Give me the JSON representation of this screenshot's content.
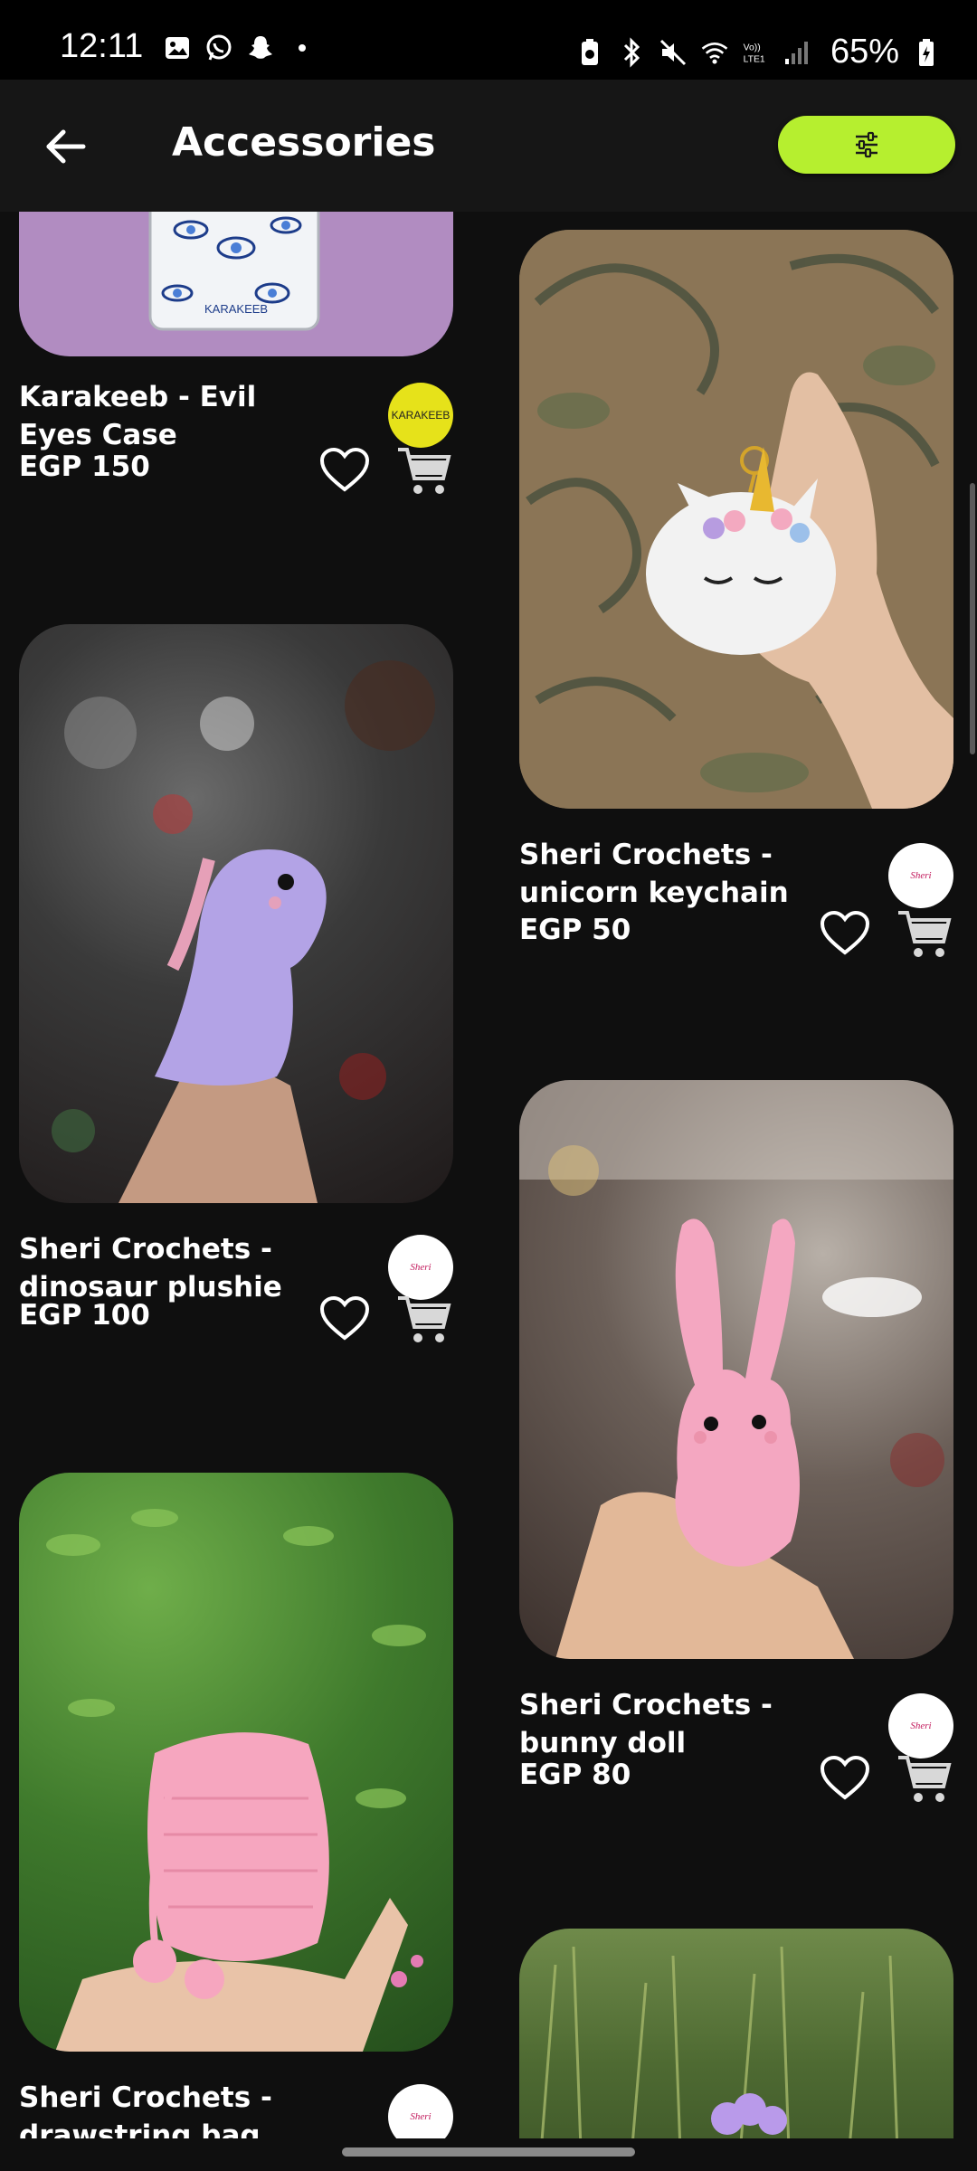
{
  "status_bar": {
    "time": "12:11",
    "battery": "65%",
    "left_icons": [
      "gallery-icon",
      "whatsapp-icon",
      "snapchat-icon",
      "dot-icon"
    ],
    "right_icons": [
      "battery-saver-icon",
      "bluetooth-icon",
      "mute-icon",
      "wifi-icon",
      "volte-icon",
      "signal-icon",
      "battery-icon"
    ]
  },
  "header": {
    "title": "Accessories",
    "back_icon": "arrow-left-icon",
    "filter_icon": "sliders-icon",
    "filter_color": "#b6ef2f"
  },
  "products": [
    {
      "title": "Karakeeb  - Evil Eyes Case",
      "price": "EGP 150",
      "logo_text": "KARAKEEB"
    },
    {
      "title": "Sheri Crochets - unicorn keychain",
      "price": "EGP 50",
      "logo_text": "Sheri"
    },
    {
      "title": "Sheri Crochets - dinosaur plushie",
      "price": "EGP 100",
      "logo_text": "Sheri"
    },
    {
      "title": "Sheri Crochets - bunny doll",
      "price": "EGP 80",
      "logo_text": "Sheri"
    },
    {
      "title": "Sheri Crochets - drawstring bag",
      "price": "",
      "logo_text": "Sheri"
    }
  ],
  "colors": {
    "background": "#0f0f0f",
    "accent": "#b6ef2f",
    "karakeeb_logo": "#e6e21a"
  }
}
